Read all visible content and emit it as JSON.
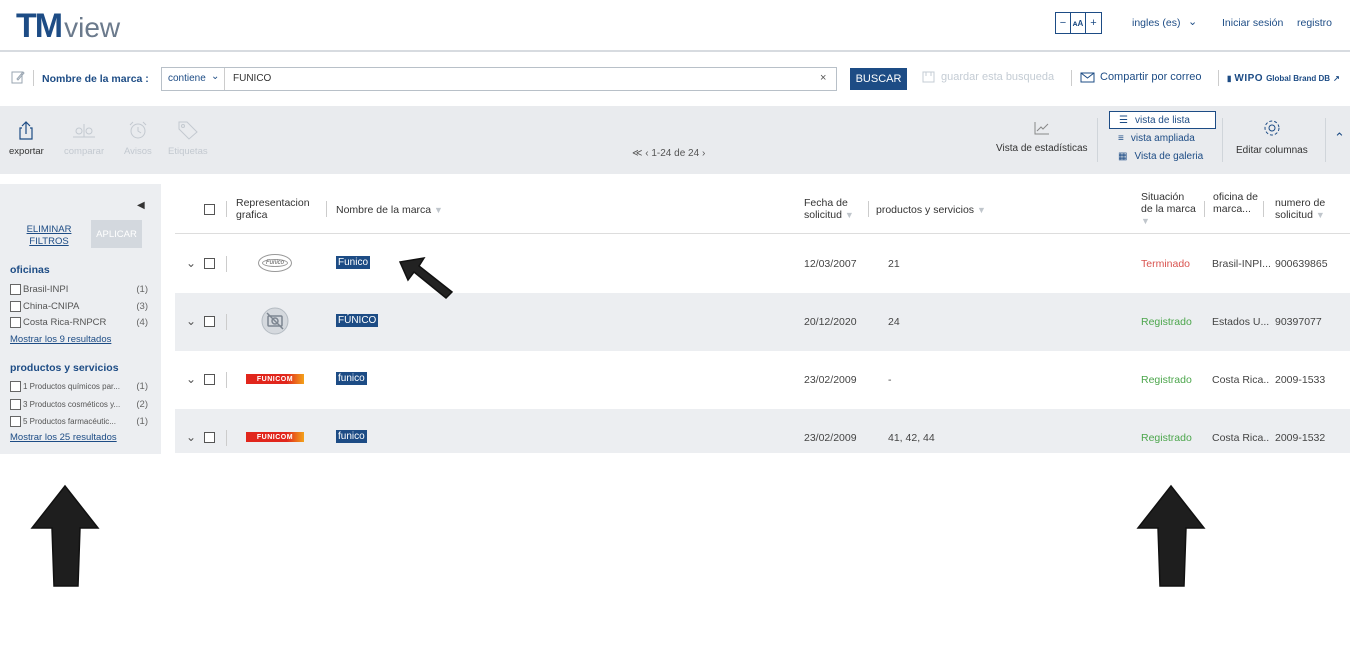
{
  "header": {
    "logo_tm": "TM",
    "logo_view": "view",
    "zoom": {
      "minus": "−",
      "reset": "ᴀA",
      "plus": "+"
    },
    "language": "ingles (es)",
    "login": "Iniciar sesión",
    "register": "registro"
  },
  "search": {
    "field_label": "Nombre de la marca :",
    "operator": "contiene",
    "value": "FUNICO",
    "clear": "×",
    "button": "BUSCAR",
    "save": "guardar esta busqueda",
    "share": "Compartir por correo",
    "wipo_brand": "WIPO",
    "wipo_db": "Global Brand DB"
  },
  "toolbar": {
    "export": "exportar",
    "compare": "comparar",
    "alerts": "Avisos",
    "labels": "Etiquetas",
    "pager": "≪ ‹ 1-24 de 24 ›",
    "stats": "Vista de estadísticas",
    "views": [
      "vista de lista",
      "vista ampliada",
      "Vista de galeria"
    ],
    "edit_columns": "Editar columnas"
  },
  "sidebar": {
    "clear_filters": "ELIMINAR FILTROS",
    "apply": "APLICAR",
    "offices_title": "oficinas",
    "offices": [
      {
        "label": "Brasil-INPI",
        "count": "(1)"
      },
      {
        "label": "China-CNIPA",
        "count": "(3)"
      },
      {
        "label": "Costa Rica-RNPCR",
        "count": "(4)"
      }
    ],
    "offices_more": "Mostrar los 9 resultados",
    "products_title": "productos y servicios",
    "products": [
      {
        "label": "1 Productos químicos par...",
        "count": "(1)"
      },
      {
        "label": "3 Productos cosméticos y...",
        "count": "(2)"
      },
      {
        "label": "5 Productos farmacéutic...",
        "count": "(1)"
      }
    ],
    "products_more": "Mostrar los 25 resultados"
  },
  "table": {
    "headers": {
      "representation": "Representacion grafica",
      "name": "Nombre de la marca",
      "date": "Fecha de solicitud",
      "products": "productos y servicios",
      "status": "Situación de la marca",
      "office": "oficina de marca...",
      "number": "numero de solicitud"
    },
    "rows": [
      {
        "name": "Funico",
        "date": "12/03/2007",
        "products": "21",
        "status": "Terminado",
        "office": "Brasil-INPI...",
        "number": "900639865",
        "logo_text": "Funico"
      },
      {
        "name": "FÚNICO",
        "date": "20/12/2020",
        "products": "24",
        "status": "Registrado",
        "office": "Estados U...",
        "number": "90397077",
        "logo_text": ""
      },
      {
        "name": "funico",
        "date": "23/02/2009",
        "products": "-",
        "status": "Registrado",
        "office": "Costa Rica...",
        "number": "2009-1533",
        "logo_text": "FUNICOM"
      },
      {
        "name": "funico",
        "date": "23/02/2009",
        "products": "41, 42, 44",
        "status": "Registrado",
        "office": "Costa Rica...",
        "number": "2009-1532",
        "logo_text": "FUNICOM"
      }
    ]
  },
  "colors": {
    "brand": "#1d4c85",
    "terminated": "#d9534f",
    "registered": "#4ca64c"
  }
}
